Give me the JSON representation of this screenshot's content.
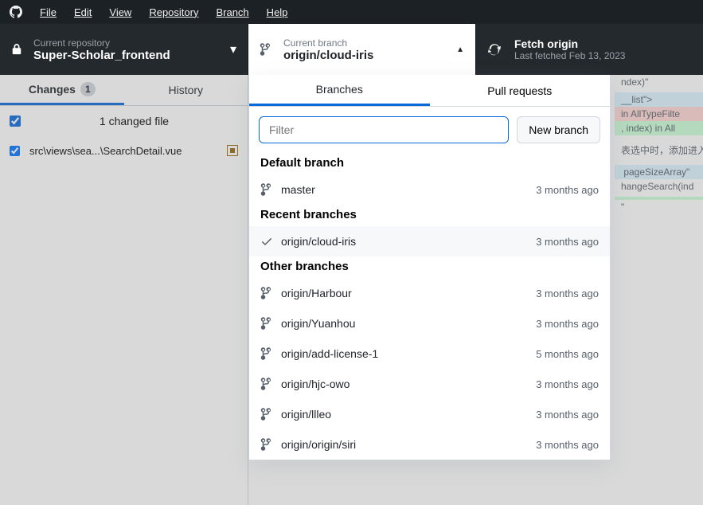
{
  "menubar": {
    "items": [
      "File",
      "Edit",
      "View",
      "Repository",
      "Branch",
      "Help"
    ]
  },
  "toolbar": {
    "repo": {
      "sub": "Current repository",
      "main": "Super-Scholar_frontend"
    },
    "branch": {
      "sub": "Current branch",
      "main": "origin/cloud-iris"
    },
    "fetch": {
      "main": "Fetch origin",
      "sub": "Last fetched Feb 13, 2023"
    }
  },
  "left_tabs": {
    "changes": "Changes",
    "changes_count": "1",
    "history": "History"
  },
  "left": {
    "changed_label": "1 changed file",
    "file_path": "src\\views\\sea...\\SearchDetail.vue"
  },
  "diff_lines": [
    {
      "cls": "",
      "t": "ndex)\""
    },
    {
      "cls": "",
      "t": ""
    },
    {
      "cls": "dl-blue",
      "t": "__list\">"
    },
    {
      "cls": "dl-red",
      "t": "in AllTypeFilte"
    },
    {
      "cls": "dl-green",
      "t": ", index) in All"
    },
    {
      "cls": "",
      "t": ""
    },
    {
      "cls": "",
      "t": ""
    },
    {
      "cls": "",
      "t": "表选中时，添加进入"
    },
    {
      "cls": "",
      "t": ""
    },
    {
      "cls": "",
      "t": ""
    },
    {
      "cls": "dl-blue",
      "t": " pageSizeArray\""
    },
    {
      "cls": "",
      "t": "hangeSearch(ind"
    },
    {
      "cls": "",
      "t": ""
    },
    {
      "cls": "dl-green",
      "t": ""
    },
    {
      "cls": "",
      "t": "\""
    }
  ],
  "dropdown": {
    "tabs": {
      "branches": "Branches",
      "pr": "Pull requests"
    },
    "filter_placeholder": "Filter",
    "new_branch": "New branch",
    "sections": {
      "default": {
        "title": "Default branch",
        "items": [
          {
            "name": "master",
            "age": "3 months ago"
          }
        ]
      },
      "recent": {
        "title": "Recent branches",
        "items": [
          {
            "name": "origin/cloud-iris",
            "age": "3 months ago"
          }
        ]
      },
      "other": {
        "title": "Other branches",
        "items": [
          {
            "name": "origin/Harbour",
            "age": "3 months ago"
          },
          {
            "name": "origin/Yuanhou",
            "age": "3 months ago"
          },
          {
            "name": "origin/add-license-1",
            "age": "5 months ago"
          },
          {
            "name": "origin/hjc-owo",
            "age": "3 months ago"
          },
          {
            "name": "origin/llleo",
            "age": "3 months ago"
          },
          {
            "name": "origin/origin/siri",
            "age": "3 months ago"
          }
        ]
      }
    }
  }
}
